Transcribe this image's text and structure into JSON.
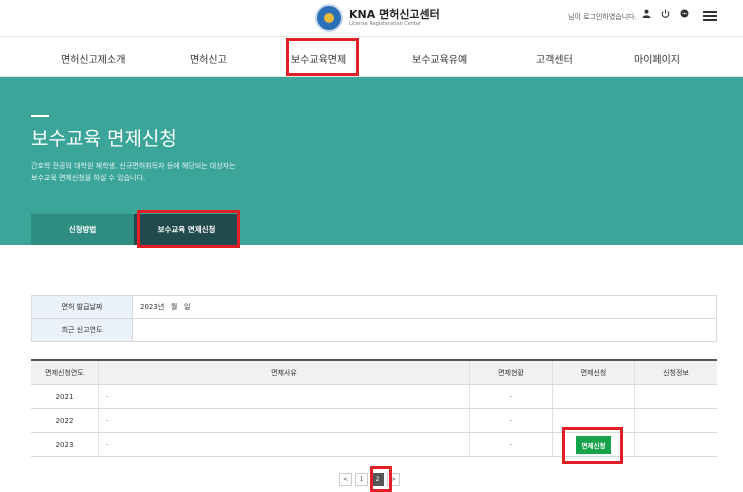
{
  "header": {
    "logo_title": "KNA 면허신고센터",
    "logo_sub": "License Registeration Center",
    "login_message": "님이 로그인하였습니다.",
    "icons": [
      "user-icon",
      "power-icon",
      "chat-icon",
      "menu-icon"
    ]
  },
  "gnb": {
    "items": [
      "면허신고제소개",
      "면허신고",
      "보수교육면제",
      "보수교육유예",
      "고객센터",
      "마이페이지"
    ]
  },
  "hero": {
    "title": "보수교육 면제신청",
    "desc_line1": "간호학 전공의 대학원 재학생, 신규면허취득자 등에 해당되는 대상자는",
    "desc_line2": "보수교육 면제신청을 하실 수 있습니다.",
    "tabs": [
      "신청방법",
      "보수교육 면제신청"
    ]
  },
  "info": {
    "rows": [
      {
        "label": "면허 발급날짜",
        "value": "2023년   월   일"
      },
      {
        "label": "최근 신고연도",
        "value": ""
      }
    ]
  },
  "table": {
    "headers": [
      "면제신청연도",
      "면제사유",
      "면제현황",
      "면제신청",
      "신청정보"
    ],
    "rows": [
      {
        "year": "2021",
        "reason": "-",
        "status": "-",
        "apply": "",
        "info": ""
      },
      {
        "year": "2022",
        "reason": "-",
        "status": "-",
        "apply": "",
        "info": ""
      },
      {
        "year": "2023",
        "reason": "-",
        "status": "-",
        "apply": "면제신청",
        "info": ""
      }
    ]
  },
  "pagination": {
    "prev": "<",
    "pages": [
      "1",
      "2"
    ],
    "current": "2",
    "next": ">"
  },
  "colors": {
    "accent": "#3aa598",
    "highlight": "#e21f26",
    "button": "#16a34a",
    "active_tab": "#214a4e"
  }
}
